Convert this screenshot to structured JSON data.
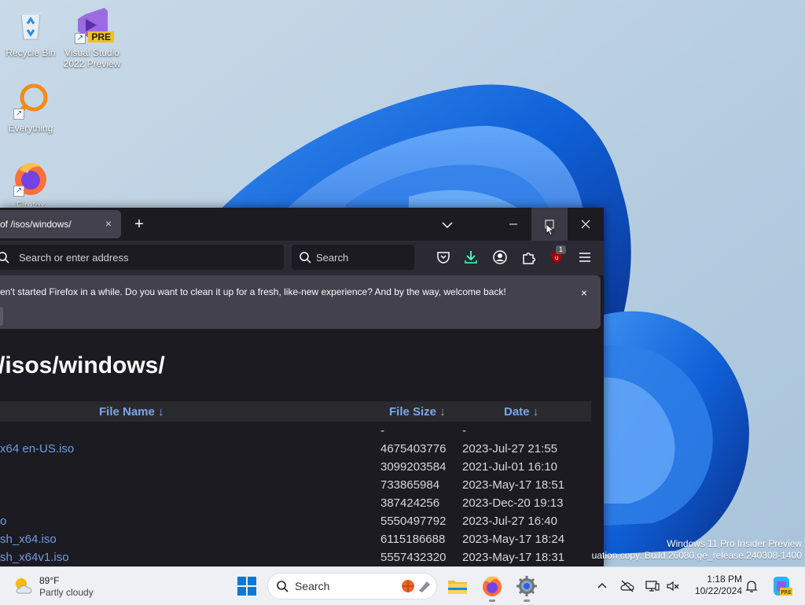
{
  "desktop": {
    "icons": [
      {
        "label": "Recycle Bin",
        "icon": "recycle-bin-icon"
      },
      {
        "label": "Visual Studio\n2022 Preview",
        "icon": "visual-studio-icon",
        "badge": "PRE"
      },
      {
        "label": "Everything",
        "icon": "everything-search-icon"
      },
      {
        "label": "Firefox",
        "icon": "firefox-icon"
      }
    ],
    "watermark": {
      "line1": "Windows 11 Pro Insider Preview",
      "line2": "uation copy. Build 26080.ge_release.240308-1400"
    }
  },
  "browser": {
    "tab": {
      "title": "of /isos/windows/",
      "close": "×"
    },
    "new_tab": "+",
    "urlbar": {
      "placeholder": "Search or enter address"
    },
    "searchbar": {
      "placeholder": "Search"
    },
    "extension_badge": "1",
    "notification": {
      "text": "en't started Firefox in a while. Do you want to clean it up for a fresh, like-new experience? And by the way, welcome back!",
      "close": "×"
    },
    "page": {
      "title": "/isos/windows/",
      "headers": {
        "name": "File Name  ↓",
        "size": "File Size  ↓",
        "date": "Date  ↓"
      },
      "rows": [
        {
          "name": "",
          "size": "-",
          "date": "-"
        },
        {
          "name": "x64 en-US.iso",
          "size": "4675403776",
          "date": "2023-Jul-27 21:55"
        },
        {
          "name": "",
          "size": "3099203584",
          "date": "2021-Jul-01 16:10"
        },
        {
          "name": "",
          "size": "733865984",
          "date": "2023-May-17 18:51"
        },
        {
          "name": "",
          "size": "387424256",
          "date": "2023-Dec-20 19:13"
        },
        {
          "name": "o",
          "size": "5550497792",
          "date": "2023-Jul-27 16:40"
        },
        {
          "name": "sh_x64.iso",
          "size": "6115186688",
          "date": "2023-May-17 18:24"
        },
        {
          "name": "sh_x64v1.iso",
          "size": "5557432320",
          "date": "2023-May-17 18:31"
        }
      ]
    }
  },
  "taskbar": {
    "weather": {
      "temp": "89°F",
      "condition": "Partly cloudy"
    },
    "search_label": "Search",
    "clock": {
      "time": "1:18 PM",
      "date": "10/22/2024"
    }
  }
}
